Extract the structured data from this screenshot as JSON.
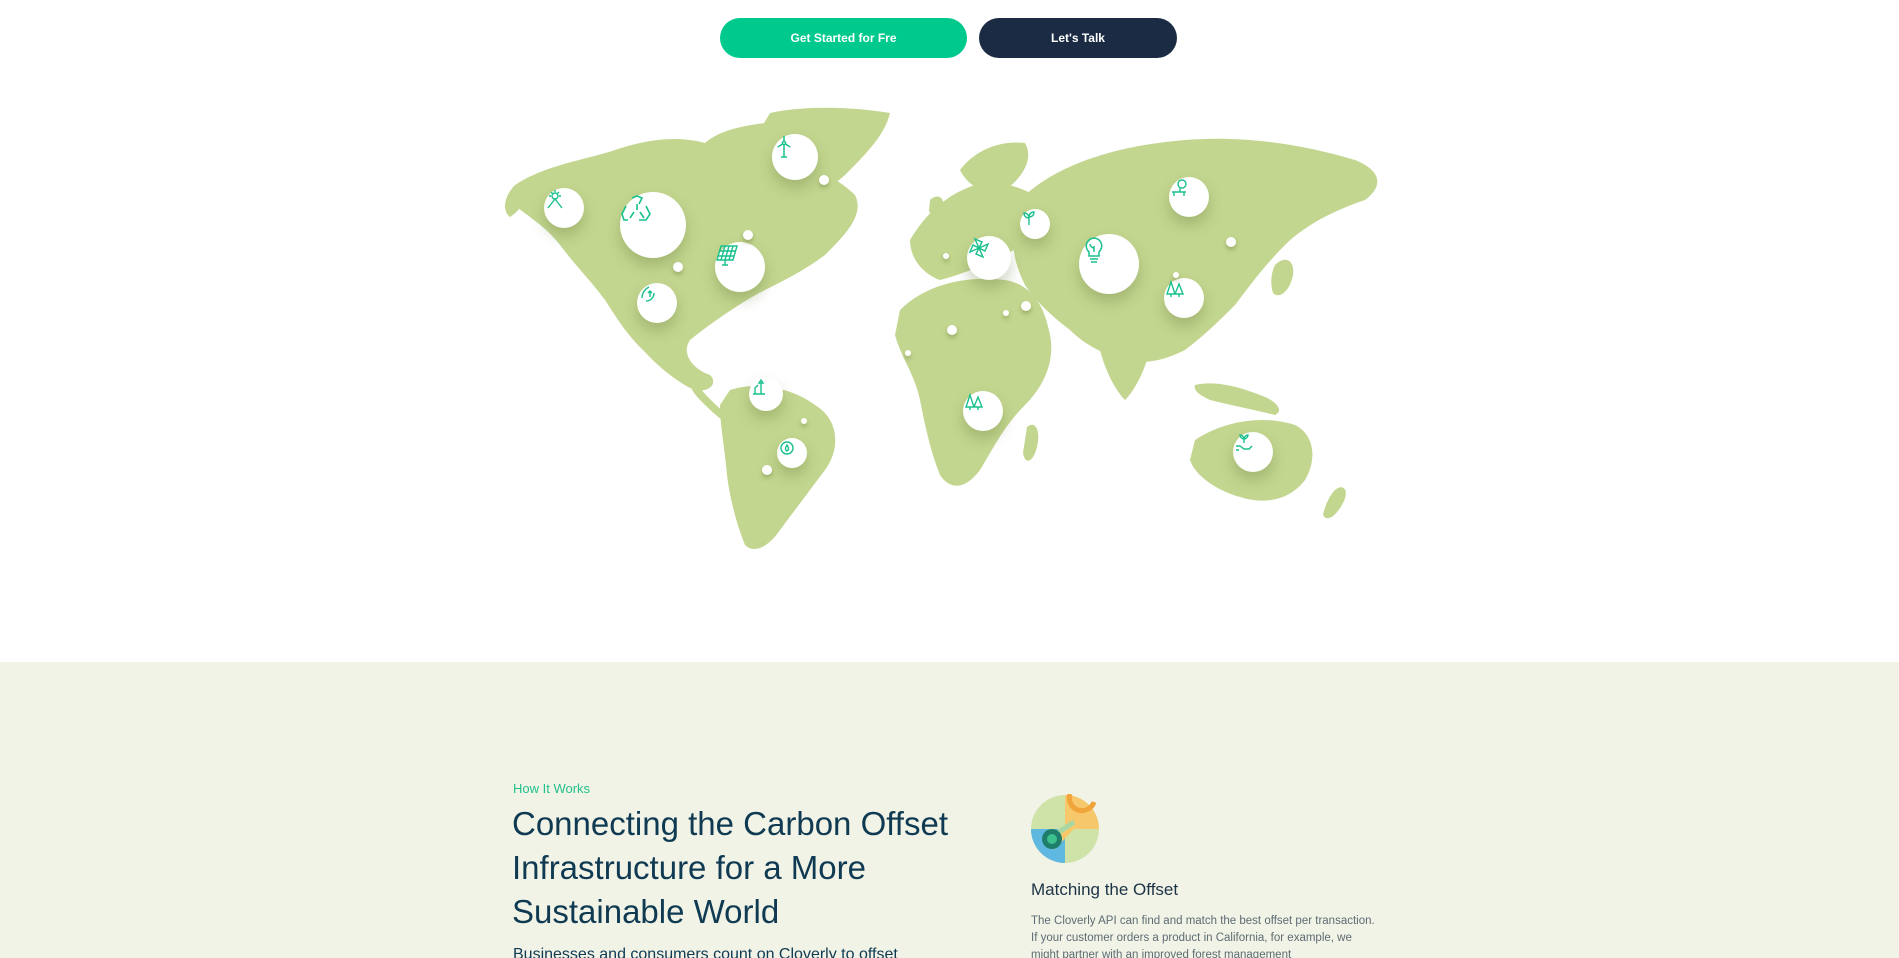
{
  "cta": {
    "primary_label": "Get Started for Fre",
    "secondary_label": "Let's Talk"
  },
  "map": {
    "land_color": "#c3d68f",
    "icon_color": "#19c08e",
    "project_icons": [
      "solar-panel-icon",
      "recycle-icon",
      "wind-turbine-icon",
      "solar-array-icon",
      "hydro-plant-icon",
      "tree-planting-icon",
      "water-cycle-icon",
      "pinwheel-icon",
      "sprout-icon",
      "lightbulb-leaf-icon",
      "cookstove-icon",
      "forest-icon",
      "forest-icon",
      "hand-sprout-icon"
    ]
  },
  "how_it_works": {
    "eyebrow": "How It Works",
    "headline": "Connecting the Carbon Offset Infrastructure for a More Sustainable World",
    "lead": "Businesses and consumers count on Cloverly to offset",
    "step": {
      "icon": "matching-offset-icon",
      "title": "Matching the Offset",
      "body": "The Cloverly API can find and match the best offset per transaction. If your customer orders a product in California, for example, we might partner with an improved forest management"
    }
  },
  "colors": {
    "primary": "#00c98d",
    "secondary": "#1b2b44",
    "section_bg": "#f1f3e7",
    "heading": "#0f3a52",
    "accent_text": "#22c08c"
  }
}
